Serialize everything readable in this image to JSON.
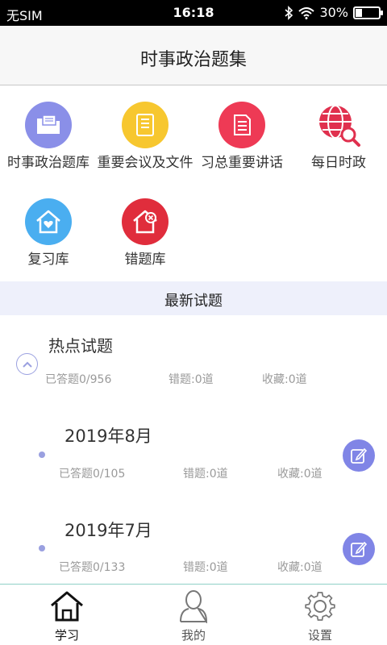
{
  "status_bar": {
    "carrier": "无SIM",
    "time": "16:18",
    "battery": "30%",
    "battery_level": 0.3
  },
  "header": {
    "title": "时事政治题集"
  },
  "grid": [
    {
      "label": "时事政治题库",
      "icon": "folder-icon",
      "color": "#8a8fe8"
    },
    {
      "label": "重要会议及文件",
      "icon": "document-icon",
      "color": "#f7c72f"
    },
    {
      "label": "习总重要讲话",
      "icon": "notes-icon",
      "color": "#ee3a55"
    },
    {
      "label": "每日时政",
      "icon": "globe-search-icon",
      "color": "#e0304e"
    },
    {
      "label": "复习库",
      "icon": "home-heart-icon",
      "color": "#4aaef0"
    },
    {
      "label": "错题库",
      "icon": "home-error-icon",
      "color": "#e02d3c"
    }
  ],
  "section": {
    "title": "最新试题"
  },
  "list": {
    "group": {
      "title": "热点试题",
      "answered": "已答题0/956",
      "wrong": "错题:0道",
      "favorites": "收藏:0道"
    },
    "items": [
      {
        "title": "2019年8月",
        "answered": "已答题0/105",
        "wrong": "错题:0道",
        "favorites": "收藏:0道"
      },
      {
        "title": "2019年7月",
        "answered": "已答题0/133",
        "wrong": "错题:0道",
        "favorites": "收藏:0道"
      }
    ]
  },
  "bottom_nav": [
    {
      "label": "学习",
      "icon": "home-icon",
      "active": true
    },
    {
      "label": "我的",
      "icon": "user-icon",
      "active": false
    },
    {
      "label": "设置",
      "icon": "gear-icon",
      "active": false
    }
  ]
}
